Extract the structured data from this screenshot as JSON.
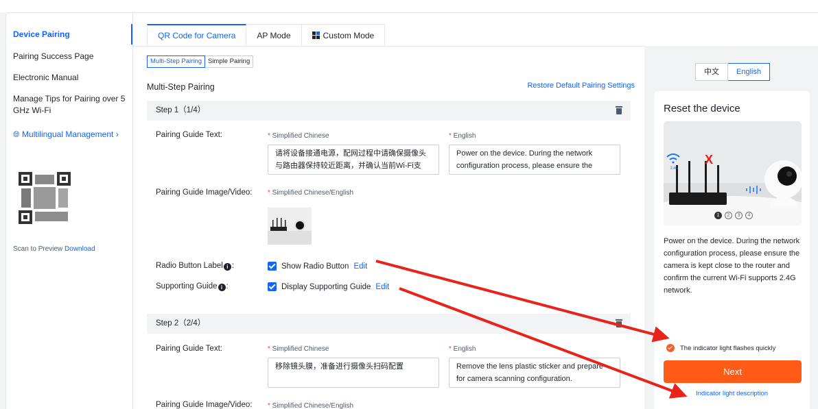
{
  "sidebar": {
    "items": [
      {
        "label": "Device Pairing",
        "active": true
      },
      {
        "label": "Pairing Success Page"
      },
      {
        "label": "Electronic Manual"
      },
      {
        "label": "Manage Tips for Pairing over 5 GHz Wi-Fi"
      }
    ],
    "multilingual": "Multilingual Management",
    "scan_label": "Scan to Preview",
    "download_label": "Download"
  },
  "tabs": [
    {
      "label": "QR Code for Camera",
      "active": true
    },
    {
      "label": "AP Mode"
    },
    {
      "label": "Custom Mode",
      "icon": "grid-icon"
    }
  ],
  "pairing_type": {
    "options": [
      "Multi-Step Pairing",
      "Simple Pairing"
    ],
    "selected": "Multi-Step Pairing"
  },
  "section": {
    "title": "Multi-Step Pairing",
    "restore": "Restore Default Pairing Settings"
  },
  "steps": [
    {
      "header": "Step 1（1/4）",
      "guide_text_label": "Pairing Guide Text:",
      "zh_label": "Simplified Chinese",
      "en_label": "English",
      "zh_text": "请将设备接通电源，配网过程中请确保摄像头与路由器保持较近距离，并确认当前Wi-Fi支",
      "en_text": "Power on the device. During the network configuration process, please ensure the",
      "image_label": "Pairing Guide Image/Video:",
      "image_lang": "Simplified Chinese/English",
      "radio_label": "Radio Button Label",
      "radio_check": "Show Radio Button",
      "support_label": "Supporting Guide",
      "support_check": "Display Supporting Guide",
      "edit": "Edit"
    },
    {
      "header": "Step 2（2/4）",
      "guide_text_label": "Pairing Guide Text:",
      "zh_label": "Simplified Chinese",
      "en_label": "English",
      "zh_text": "移除镜头膜，准备进行摄像头扫码配置",
      "en_text": "Remove the lens plastic sticker and prepare for camera scanning configuration.",
      "image_label": "Pairing Guide Image/Video:",
      "image_lang": "Simplified Chinese/English"
    }
  ],
  "preview": {
    "lang_options": [
      "中文",
      "English"
    ],
    "lang_selected": "English",
    "title": "Reset the device",
    "pages": [
      "1",
      "2",
      "3",
      "4"
    ],
    "description": "Power on the device. During the network configuration process, please ensure the camera is kept close to the router and confirm the current Wi-Fi supports 2.4G network.",
    "light_check": "The indicator light flashes quickly",
    "next": "Next",
    "indicator_link": "Indicator light description"
  },
  "colors": {
    "accent": "#1463ff",
    "next_button": "#ff5a16",
    "arrow": "#e8231c"
  }
}
